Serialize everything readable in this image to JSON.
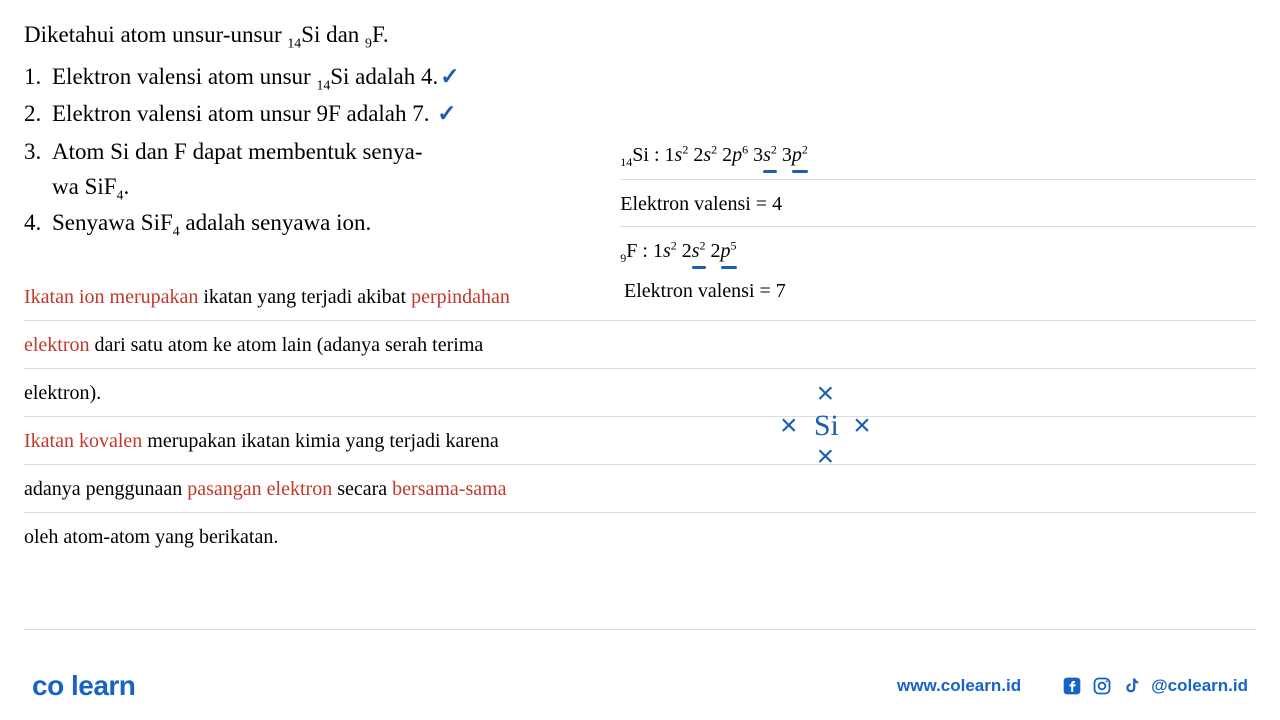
{
  "question": {
    "intro_pre": "Diketahui atom unsur-unsur ",
    "intro_si_sub": "14",
    "intro_si": "Si dan ",
    "intro_f_sub": "9",
    "intro_f": "F."
  },
  "items": [
    {
      "num": "1.",
      "pre": "Elektron valensi atom unsur ",
      "sub": "14",
      "post": "Si adalah 4.",
      "check": "✓"
    },
    {
      "num": "2.",
      "pre": "Elektron valensi atom unsur 9F adalah 7. ",
      "check": "✓"
    },
    {
      "num": "3.",
      "pre": "Atom Si dan F dapat membentuk senya-",
      "cont": "wa SiF",
      "cont_sub": "4",
      "cont_post": "."
    },
    {
      "num": "4.",
      "pre": "Senyawa SiF",
      "sub": "4",
      "post": " adalah senyawa ion."
    }
  ],
  "right": {
    "si_label": "Si : 1",
    "si_sub": "14",
    "si_config_parts": {
      "s1": "s",
      "s1e": "2",
      "s2_pre": " 2",
      "s2": "s",
      "s2e": "2",
      "p2_pre": " 2",
      "p2": "p",
      "p2e": "6",
      "s3_pre": " 3",
      "s3": "s",
      "s3e": "2",
      "p3_pre": " 3",
      "p3": "p",
      "p3e": "2"
    },
    "si_valence": "Elektron valensi = 4",
    "f_sub": "9",
    "f_label": "F : 1",
    "f_config_parts": {
      "s1": "s",
      "s1e": "2",
      "s2_pre": " 2",
      "s2": "s",
      "s2e": "2",
      "p2_pre": " 2",
      "p2": "p",
      "p2e": "5"
    },
    "f_valence": "Elektron valensi = 7",
    "diagram_x": "×",
    "diagram_si": "Si"
  },
  "explain": [
    [
      {
        "text": "Ikatan ion merupakan",
        "red": true
      },
      {
        "text": " ikatan yang terjadi akibat "
      },
      {
        "text": "perpindahan",
        "red": true
      }
    ],
    [
      {
        "text": "elektron",
        "red": true
      },
      {
        "text": " dari satu atom ke atom lain (adanya serah terima"
      }
    ],
    [
      {
        "text": "elektron)."
      }
    ],
    [
      {
        "text": "Ikatan kovalen",
        "red": true
      },
      {
        "text": " merupakan ikatan kimia yang terjadi karena"
      }
    ],
    [
      {
        "text": "adanya penggunaan "
      },
      {
        "text": "pasangan elektron",
        "red": true
      },
      {
        "text": " secara "
      },
      {
        "text": "bersama-sama",
        "red": true
      }
    ],
    [
      {
        "text": "oleh atom-atom yang berikatan."
      }
    ]
  ],
  "footer": {
    "logo_a": "co",
    "logo_b": "learn",
    "website": "www.colearn.id",
    "handle": "@colearn.id"
  }
}
